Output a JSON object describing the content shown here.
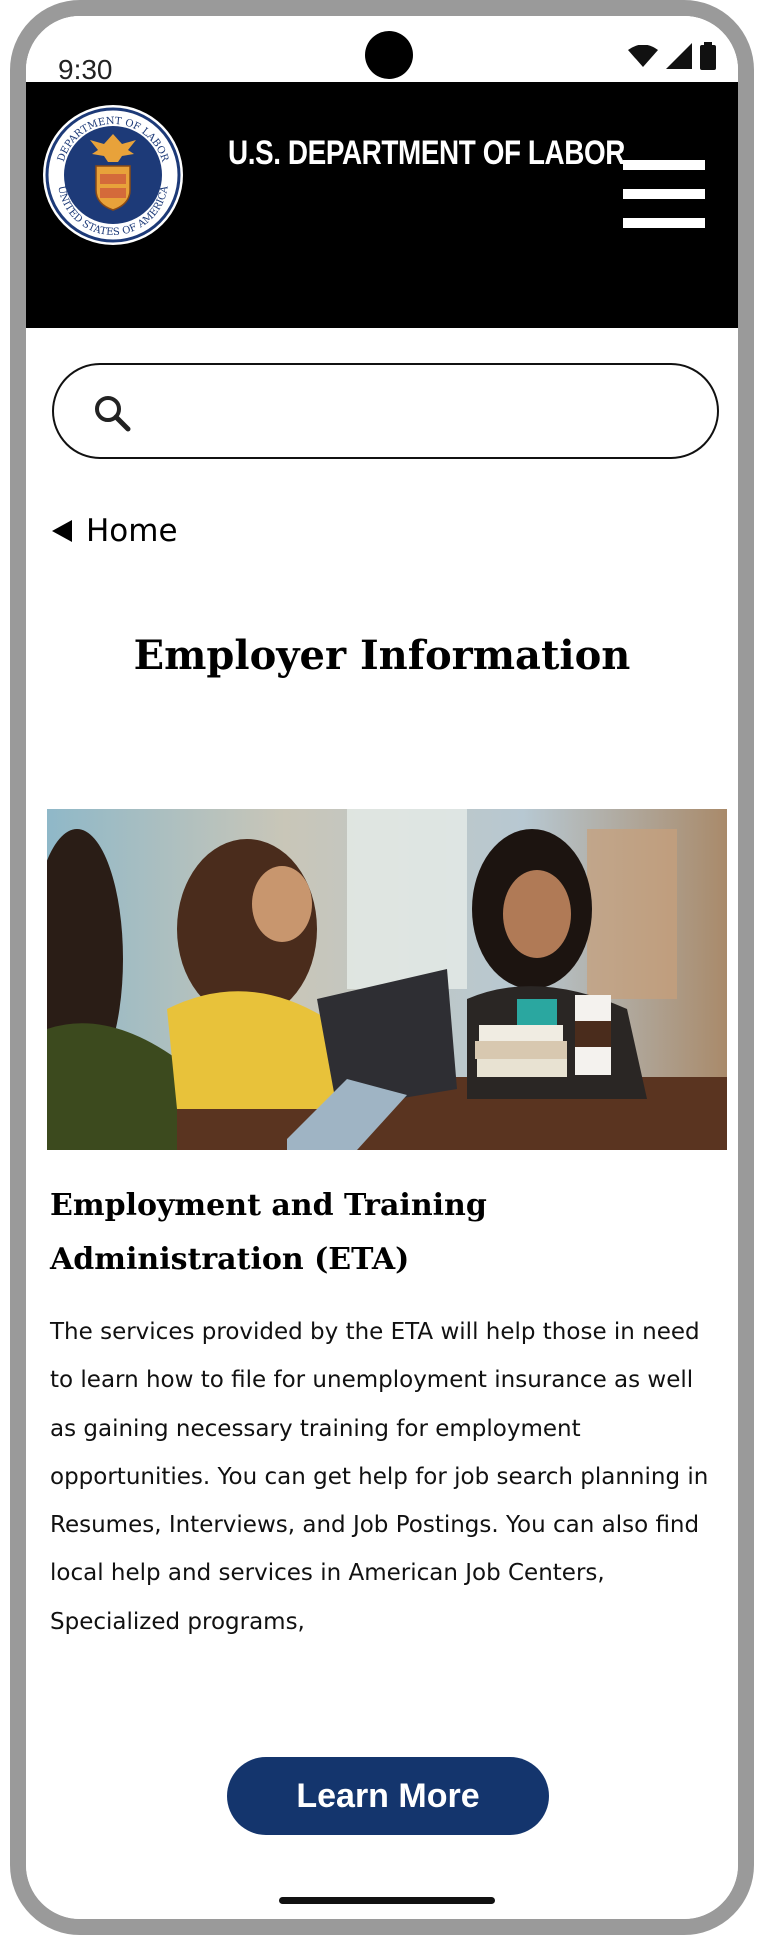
{
  "status_bar": {
    "time": "9:30"
  },
  "header": {
    "title": "U.S. DEPARTMENT OF LABOR",
    "seal_text_top": "DEPARTMENT OF LABOR",
    "seal_text_bottom": "UNITED STATES OF AMERICA"
  },
  "search": {
    "placeholder": "",
    "value": ""
  },
  "breadcrumb": {
    "label": "Home"
  },
  "page": {
    "title": "Employer Information"
  },
  "section": {
    "heading": "Employment and Training Administration (ETA)",
    "body": "The services provided by the ETA will help those in need to learn how to file for unemployment insurance as well as gaining necessary training for employment opportunities. You can get help for job search planning in Resumes,  Interviews, and Job Postings. You can also find local help and services in American Job Centers, Specialized programs,",
    "button_label": "Learn More"
  },
  "colors": {
    "header_bg": "#000000",
    "button_bg": "#14356d",
    "frame": "#9a9a9a"
  },
  "icons": {
    "search": "search-icon",
    "menu": "hamburger-menu-icon",
    "back": "back-arrow-icon",
    "wifi": "wifi-icon",
    "signal": "signal-icon",
    "battery": "battery-icon"
  }
}
